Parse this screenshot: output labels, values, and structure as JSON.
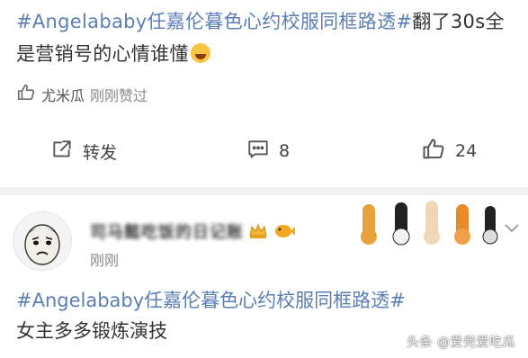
{
  "post": {
    "topic": "#Angelababy任嘉伦暮色心约校服同框路透#",
    "body": "翻了30s全是营销号的心情谁懂",
    "emoji": "laughing-tears-emoji"
  },
  "liked_by": {
    "user": "尤米瓜",
    "suffix": "刚刚赞过"
  },
  "actions": {
    "repost_label": "转发",
    "comment_count": "8",
    "like_count": "24"
  },
  "comment": {
    "username": "司马懿吃饭的日记账",
    "time": "刚刚",
    "topic": "#Angelababy任嘉伦暮色心约校服同框路透#",
    "body": "女主多多锻炼演技"
  },
  "watermark": "头条 @爱兜爱吃瓜",
  "colors": {
    "topic_link": "#5b7fb5",
    "muted_text": "#8a8a8a",
    "separator": "#f1f1f1"
  },
  "icons": [
    "like-outline-icon",
    "repost-icon",
    "comment-icon",
    "like-icon",
    "chevron-down-icon",
    "crown-badge-icon",
    "paw-decoration-icon"
  ]
}
